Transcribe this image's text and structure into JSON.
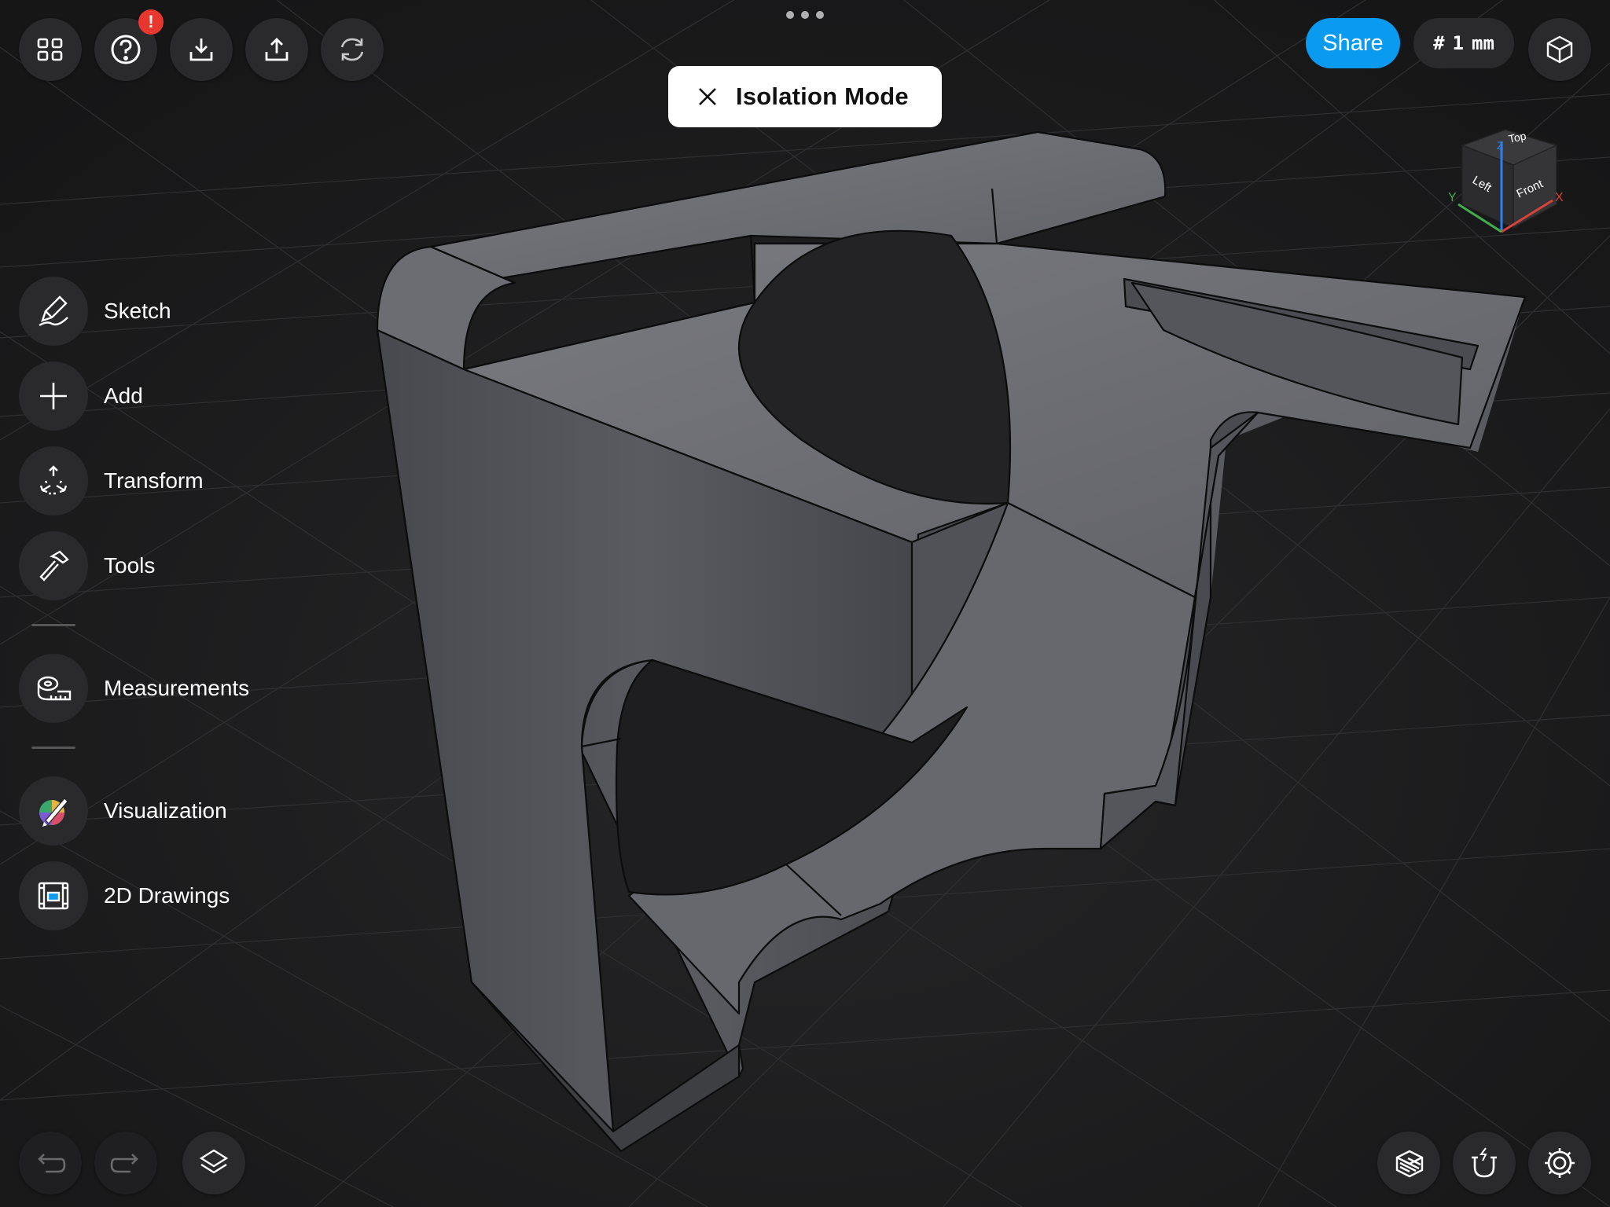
{
  "toolbar": {
    "left_buttons": [
      "projects-icon",
      "help-icon",
      "import-icon",
      "export-icon",
      "sync-icon"
    ],
    "help_badge": "!",
    "share_label": "Share",
    "grid": {
      "symbol": "#",
      "value": "1",
      "unit": "mm"
    }
  },
  "isolation": {
    "title": "Isolation Mode"
  },
  "side_menu": {
    "items": [
      {
        "label": "Sketch",
        "icon": "pencil-icon"
      },
      {
        "label": "Add",
        "icon": "plus-icon"
      },
      {
        "label": "Transform",
        "icon": "transform-arrows-icon"
      },
      {
        "label": "Tools",
        "icon": "hammer-icon"
      },
      {
        "label": "Measurements",
        "icon": "tape-measure-icon"
      },
      {
        "label": "Visualization",
        "icon": "paintbrush-icon"
      },
      {
        "label": "2D Drawings",
        "icon": "blueprint-icon"
      }
    ]
  },
  "nav_cube": {
    "top": "Top",
    "left": "Left",
    "front": "Front",
    "axis_x": "X",
    "axis_y": "Y",
    "axis_z": "Z"
  },
  "bottom_left": [
    "undo-icon",
    "redo-icon",
    "layers-icon"
  ],
  "bottom_right": [
    "section-view-icon",
    "snap-magnet-icon",
    "settings-gear-icon"
  ],
  "colors": {
    "accent": "#0a9bf0",
    "background": "#1a1a1b",
    "button": "#2a2a2c",
    "badge": "#e8372f"
  }
}
